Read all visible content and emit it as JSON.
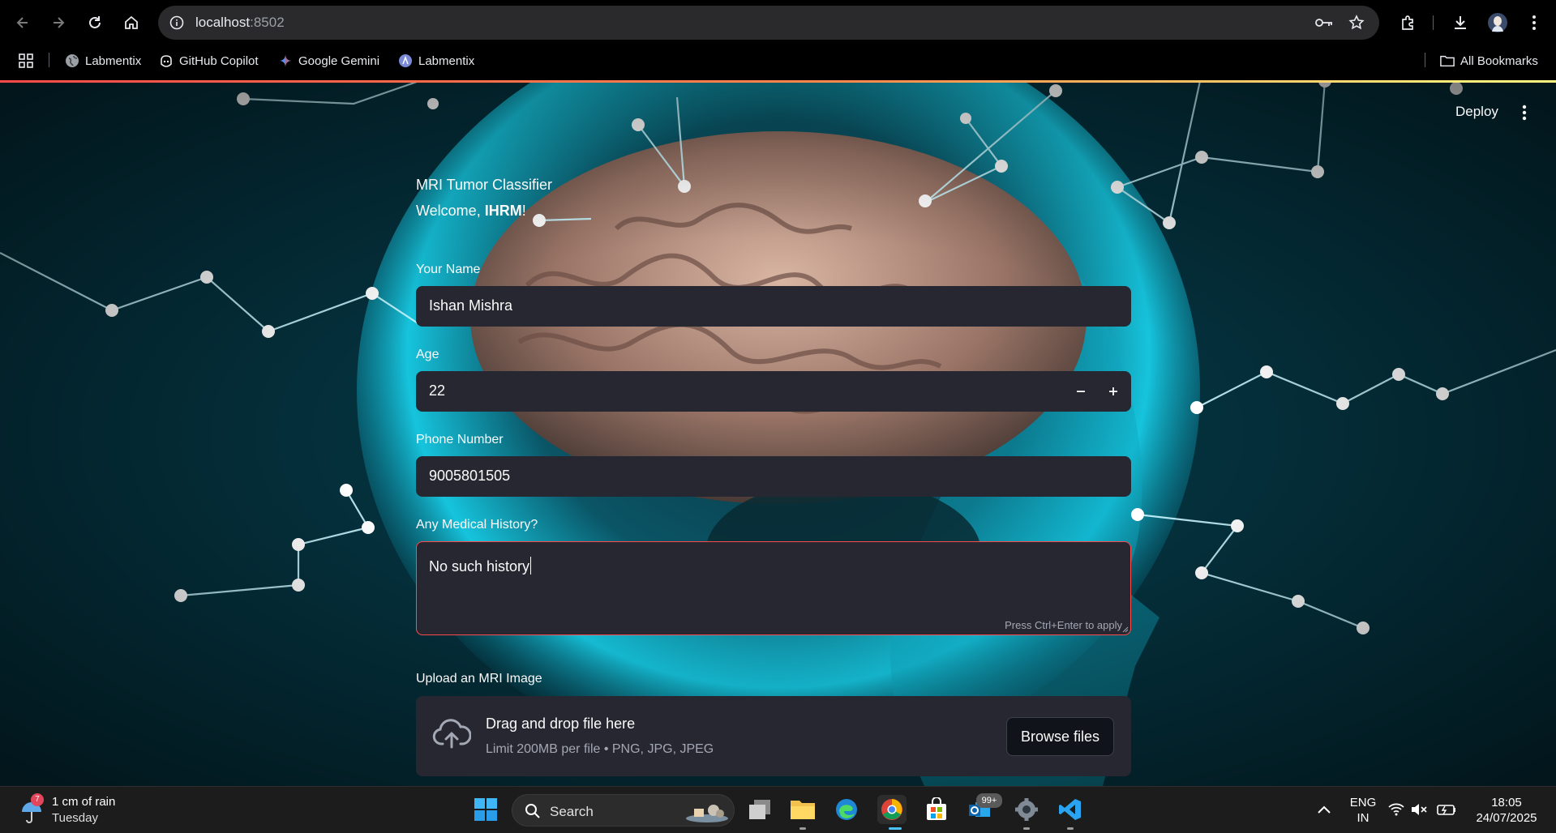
{
  "browser": {
    "url_host": "localhost",
    "url_port": ":8502",
    "bookmarks": [
      {
        "label": "Labmentix",
        "icon": "globe-icon"
      },
      {
        "label": "GitHub Copilot",
        "icon": "copilot-icon"
      },
      {
        "label": "Google Gemini",
        "icon": "gemini-icon"
      },
      {
        "label": "Labmentix",
        "icon": "labmentix-icon"
      }
    ],
    "all_bookmarks": "All Bookmarks"
  },
  "app": {
    "deploy_label": "Deploy",
    "title": "MRI Tumor Classifier",
    "welcome_prefix": "Welcome, ",
    "welcome_name": "IHRM",
    "welcome_suffix": "!",
    "name_label": "Your Name",
    "name_value": "Ishan Mishra",
    "age_label": "Age",
    "age_value": "22",
    "phone_label": "Phone Number",
    "phone_value": "9005801505",
    "history_label": "Any Medical History?",
    "history_value": "No such history",
    "history_hint": "Press Ctrl+Enter to apply",
    "upload_label": "Upload an MRI Image",
    "upload_title": "Drag and drop file here",
    "upload_limit": "Limit 200MB per file • PNG, JPG, JPEG",
    "browse_label": "Browse files"
  },
  "taskbar": {
    "weather_badge": "7",
    "weather_text": "1 cm of rain",
    "weather_day": "Tuesday",
    "search_label": "Search",
    "mail_badge": "99+",
    "lang_line1": "ENG",
    "lang_line2": "IN",
    "time": "18:05",
    "date": "24/07/2025"
  },
  "colors": {
    "accent": "#ff4b4b",
    "input_bg": "#262730",
    "chrome_bg": "#000000",
    "taskbar_bg": "#1c1c1c"
  }
}
